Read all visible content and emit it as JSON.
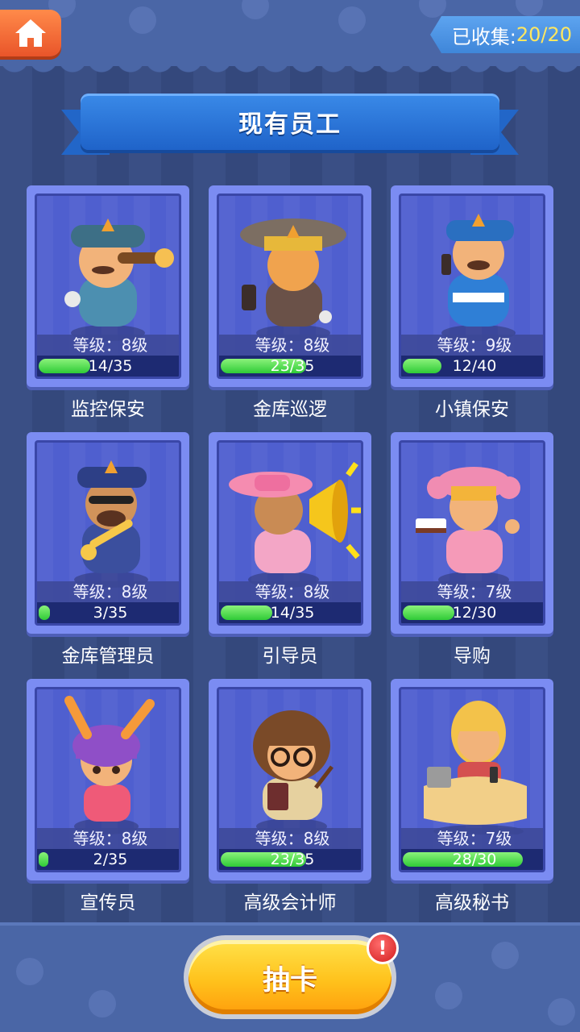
{
  "header": {
    "collected_label": "已收集:",
    "collected_value": "20/20"
  },
  "title": "现有员工",
  "staff": [
    {
      "name": "监控保安",
      "level": "等级：8级",
      "progress_text": "14/35",
      "progress": 0.4,
      "icon": "security-guard-telescope"
    },
    {
      "name": "金库巡逻",
      "level": "等级：8级",
      "progress_text": "23/35",
      "progress": 0.66,
      "icon": "vault-patrol"
    },
    {
      "name": "小镇保安",
      "level": "等级：9级",
      "progress_text": "12/40",
      "progress": 0.3,
      "icon": "town-guard"
    },
    {
      "name": "金库管理员",
      "level": "等级：8级",
      "progress_text": "3/35",
      "progress": 0.086,
      "icon": "vault-keeper"
    },
    {
      "name": "引导员",
      "level": "等级：8级",
      "progress_text": "14/35",
      "progress": 0.4,
      "icon": "guide-megaphone"
    },
    {
      "name": "导购",
      "level": "等级：7级",
      "progress_text": "12/30",
      "progress": 0.4,
      "icon": "shopping-guide"
    },
    {
      "name": "宣传员",
      "level": "等级：8级",
      "progress_text": "2/35",
      "progress": 0.057,
      "icon": "promoter-bunny"
    },
    {
      "name": "高级会计师",
      "level": "等级：8级",
      "progress_text": "23/35",
      "progress": 0.66,
      "icon": "senior-accountant"
    },
    {
      "name": "高级秘书",
      "level": "等级：7级",
      "progress_text": "28/30",
      "progress": 0.93,
      "icon": "senior-secretary"
    }
  ],
  "draw_button": "抽卡",
  "alert_badge": "!",
  "colors": {
    "background": "#364a7d",
    "card_frame": "#7b8cf2",
    "progress_fill": "#2fcb37",
    "button": "#ffc21c",
    "accent_text": "#ffe760"
  }
}
